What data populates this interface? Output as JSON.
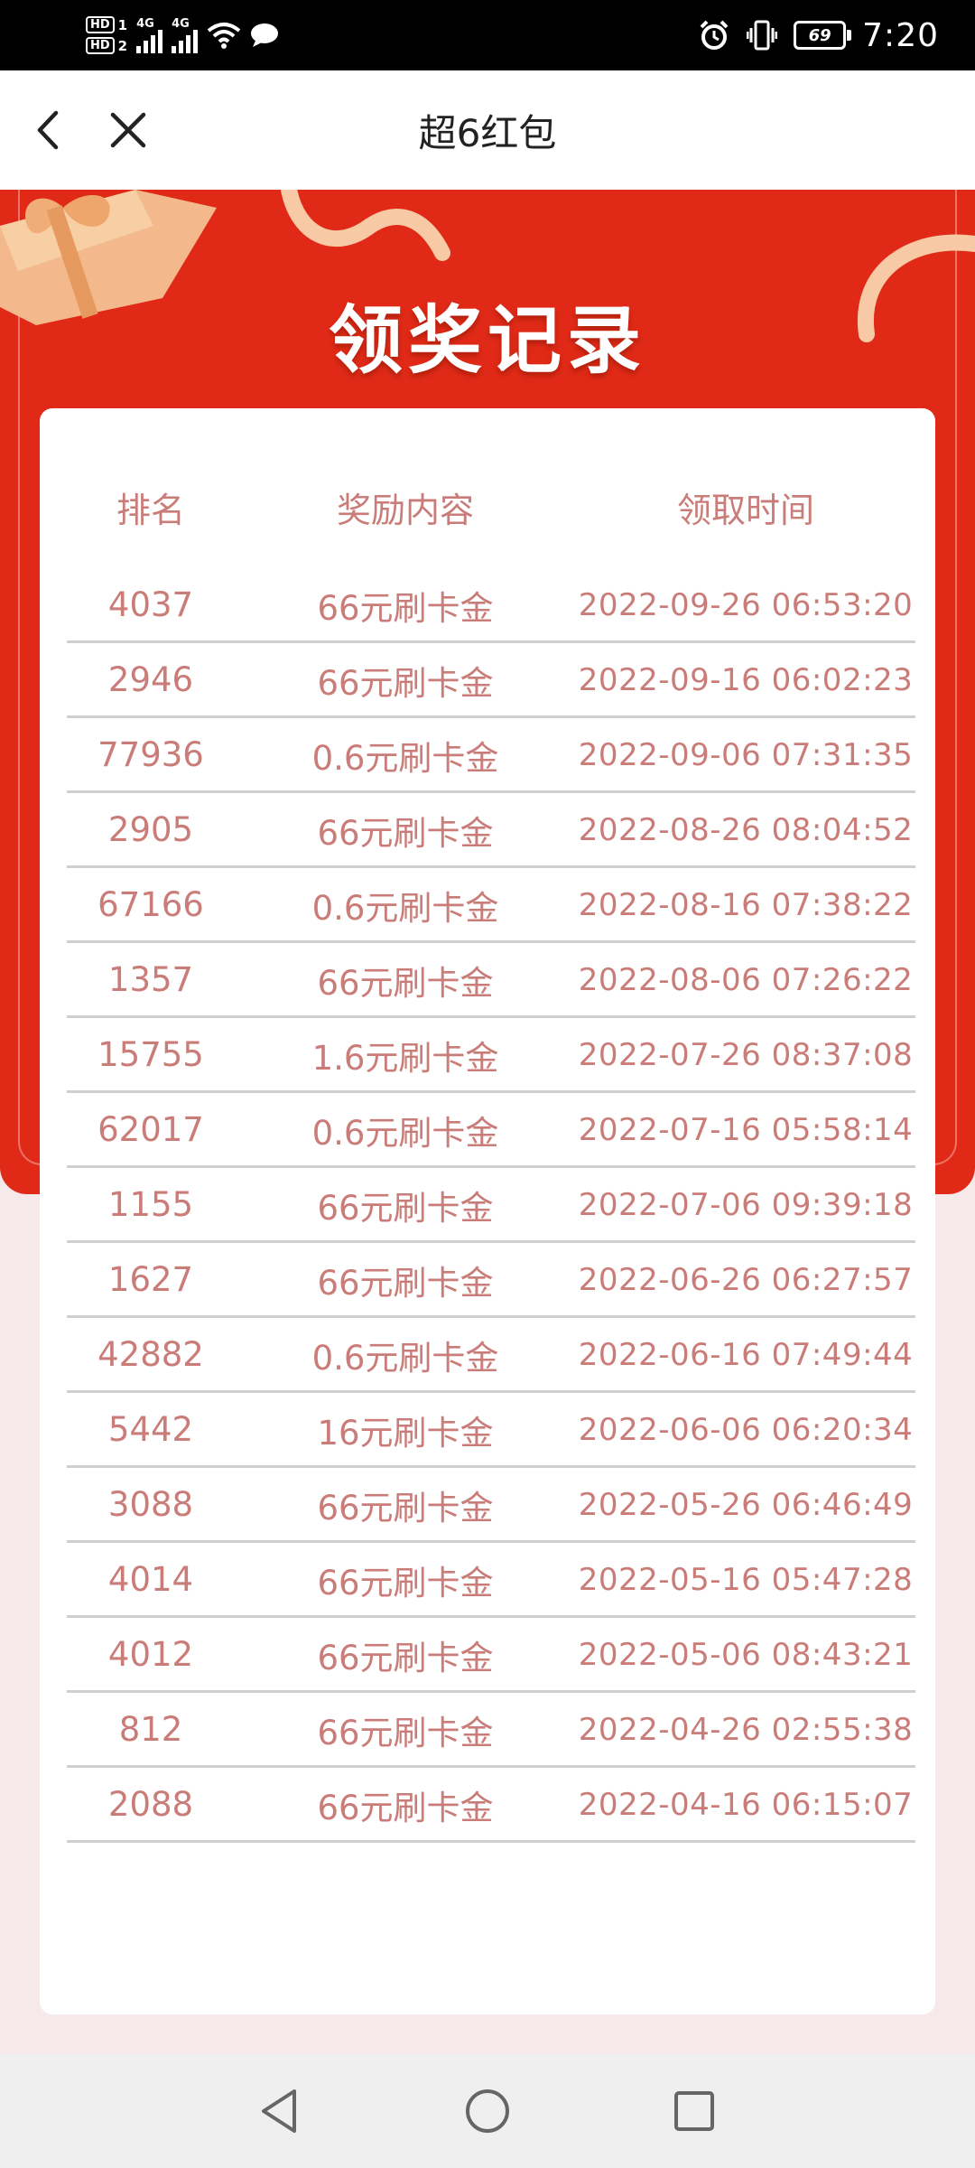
{
  "status": {
    "time": "7:20",
    "battery": "69",
    "sim1": "HD",
    "sim1_num": "1",
    "sim2": "HD",
    "sim2_num": "2",
    "net1": "4G",
    "net2": "4G"
  },
  "header": {
    "title": "超6红包"
  },
  "banner": {
    "title": "领奖记录"
  },
  "table": {
    "headers": [
      "排名",
      "奖励内容",
      "领取时间"
    ],
    "rows": [
      {
        "rank": "4037",
        "reward": "66元刷卡金",
        "time": "2022-09-26 06:53:20"
      },
      {
        "rank": "2946",
        "reward": "66元刷卡金",
        "time": "2022-09-16 06:02:23"
      },
      {
        "rank": "77936",
        "reward": "0.6元刷卡金",
        "time": "2022-09-06 07:31:35"
      },
      {
        "rank": "2905",
        "reward": "66元刷卡金",
        "time": "2022-08-26 08:04:52"
      },
      {
        "rank": "67166",
        "reward": "0.6元刷卡金",
        "time": "2022-08-16 07:38:22"
      },
      {
        "rank": "1357",
        "reward": "66元刷卡金",
        "time": "2022-08-06 07:26:22"
      },
      {
        "rank": "15755",
        "reward": "1.6元刷卡金",
        "time": "2022-07-26 08:37:08"
      },
      {
        "rank": "62017",
        "reward": "0.6元刷卡金",
        "time": "2022-07-16 05:58:14"
      },
      {
        "rank": "1155",
        "reward": "66元刷卡金",
        "time": "2022-07-06 09:39:18"
      },
      {
        "rank": "1627",
        "reward": "66元刷卡金",
        "time": "2022-06-26 06:27:57"
      },
      {
        "rank": "42882",
        "reward": "0.6元刷卡金",
        "time": "2022-06-16 07:49:44"
      },
      {
        "rank": "5442",
        "reward": "16元刷卡金",
        "time": "2022-06-06 06:20:34"
      },
      {
        "rank": "3088",
        "reward": "66元刷卡金",
        "time": "2022-05-26 06:46:49"
      },
      {
        "rank": "4014",
        "reward": "66元刷卡金",
        "time": "2022-05-16 05:47:28"
      },
      {
        "rank": "4012",
        "reward": "66元刷卡金",
        "time": "2022-05-06 08:43:21"
      },
      {
        "rank": "812",
        "reward": "66元刷卡金",
        "time": "2022-04-26 02:55:38"
      },
      {
        "rank": "2088",
        "reward": "66元刷卡金",
        "time": "2022-04-16 06:15:07"
      }
    ]
  },
  "colors": {
    "banner_red": "#e02a17",
    "text_pink": "#c97c78",
    "page_bg": "#f6e9ea"
  },
  "icons": [
    "back-arrow-icon",
    "close-icon",
    "gift-box-icon",
    "ribbon-icon",
    "nav-back-icon",
    "nav-home-icon",
    "nav-recents-icon"
  ]
}
